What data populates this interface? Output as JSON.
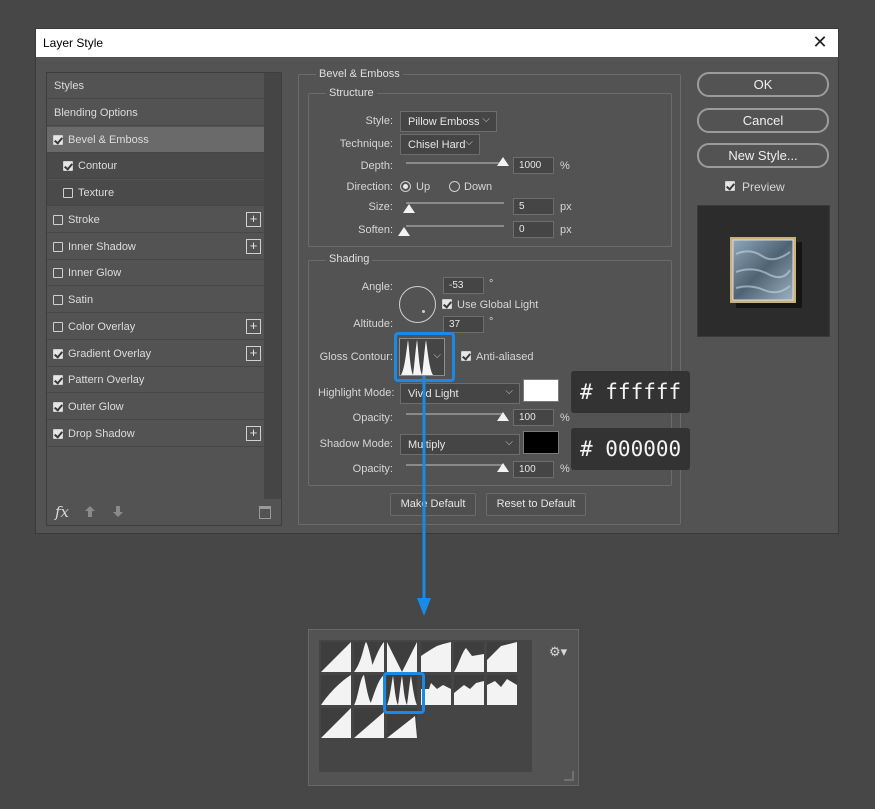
{
  "dialog": {
    "title": "Layer Style",
    "close_icon": "close-icon"
  },
  "styles_list": {
    "items": [
      {
        "label": "Styles",
        "checkbox": false,
        "checked": false,
        "plus": false,
        "active": false,
        "sub": false
      },
      {
        "label": "Blending Options",
        "checkbox": false,
        "checked": false,
        "plus": false,
        "active": false,
        "sub": false
      },
      {
        "label": "Bevel & Emboss",
        "checkbox": true,
        "checked": true,
        "plus": false,
        "active": true,
        "sub": false
      },
      {
        "label": "Contour",
        "checkbox": true,
        "checked": true,
        "plus": false,
        "active": false,
        "sub": true
      },
      {
        "label": "Texture",
        "checkbox": true,
        "checked": false,
        "plus": false,
        "active": false,
        "sub": true
      },
      {
        "label": "Stroke",
        "checkbox": true,
        "checked": false,
        "plus": true,
        "active": false,
        "sub": false
      },
      {
        "label": "Inner Shadow",
        "checkbox": true,
        "checked": false,
        "plus": true,
        "active": false,
        "sub": false
      },
      {
        "label": "Inner Glow",
        "checkbox": true,
        "checked": false,
        "plus": false,
        "active": false,
        "sub": false
      },
      {
        "label": "Satin",
        "checkbox": true,
        "checked": false,
        "plus": false,
        "active": false,
        "sub": false
      },
      {
        "label": "Color Overlay",
        "checkbox": true,
        "checked": false,
        "plus": true,
        "active": false,
        "sub": false
      },
      {
        "label": "Gradient Overlay",
        "checkbox": true,
        "checked": true,
        "plus": true,
        "active": false,
        "sub": false
      },
      {
        "label": "Pattern Overlay",
        "checkbox": true,
        "checked": true,
        "plus": false,
        "active": false,
        "sub": false
      },
      {
        "label": "Outer Glow",
        "checkbox": true,
        "checked": true,
        "plus": false,
        "active": false,
        "sub": false
      },
      {
        "label": "Drop Shadow",
        "checkbox": true,
        "checked": true,
        "plus": true,
        "active": false,
        "sub": false
      }
    ],
    "fx_label": "fx",
    "plus_symbol": "+"
  },
  "bevel": {
    "section_title": "Bevel & Emboss",
    "structure": {
      "title": "Structure",
      "style_label": "Style:",
      "style_value": "Pillow Emboss",
      "technique_label": "Technique:",
      "technique_value": "Chisel Hard",
      "depth_label": "Depth:",
      "depth_value": "1000",
      "depth_unit": "%",
      "direction_label": "Direction:",
      "direction_up": "Up",
      "direction_down": "Down",
      "direction_selected": "Up",
      "size_label": "Size:",
      "size_value": "5",
      "size_unit": "px",
      "soften_label": "Soften:",
      "soften_value": "0",
      "soften_unit": "px"
    },
    "shading": {
      "title": "Shading",
      "angle_label": "Angle:",
      "angle_value": "-53",
      "angle_unit": "°",
      "use_global_light_label": "Use Global Light",
      "use_global_light_checked": true,
      "altitude_label": "Altitude:",
      "altitude_value": "37",
      "altitude_unit": "°",
      "gloss_contour_label": "Gloss Contour:",
      "anti_aliased_label": "Anti-aliased",
      "anti_aliased_checked": true,
      "highlight_mode_label": "Highlight Mode:",
      "highlight_mode_value": "Vivid Light",
      "highlight_color": "#ffffff",
      "highlight_hex_label": "# ffffff",
      "highlight_opacity_label": "Opacity:",
      "highlight_opacity_value": "100",
      "highlight_opacity_unit": "%",
      "shadow_mode_label": "Shadow Mode:",
      "shadow_mode_value": "Multiply",
      "shadow_color": "#000000",
      "shadow_hex_label": "# 000000",
      "shadow_opacity_label": "Opacity:",
      "shadow_opacity_value": "100",
      "shadow_opacity_unit": "%"
    },
    "make_default_label": "Make Default",
    "reset_default_label": "Reset to Default"
  },
  "side_buttons": {
    "ok_label": "OK",
    "cancel_label": "Cancel",
    "new_style_label": "New Style...",
    "preview_label": "Preview",
    "preview_checked": true
  },
  "colors": {
    "accent": "#1a8ae8",
    "panel": "#535353",
    "background": "#474747"
  }
}
